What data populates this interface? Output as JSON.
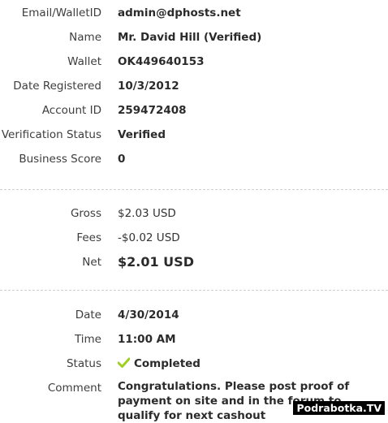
{
  "account": {
    "email_label": "Email/WalletID",
    "email_value": "admin@dphosts.net",
    "name_label": "Name",
    "name_value": "Mr. David Hill (Verified)",
    "wallet_label": "Wallet",
    "wallet_value": "OK449640153",
    "registered_label": "Date Registered",
    "registered_value": "10/3/2012",
    "account_id_label": "Account ID",
    "account_id_value": "259472408",
    "verification_label": "Verification Status",
    "verification_value": "Verified",
    "score_label": "Business Score",
    "score_value": "0"
  },
  "amounts": {
    "gross_label": "Gross",
    "gross_value": "$2.03 USD",
    "fees_label": "Fees",
    "fees_value": "-$0.02 USD",
    "net_label": "Net",
    "net_value": "$2.01 USD"
  },
  "transaction": {
    "date_label": "Date",
    "date_value": "4/30/2014",
    "time_label": "Time",
    "time_value": "11:00 AM",
    "status_label": "Status",
    "status_value": "Completed",
    "status_icon": "check-icon",
    "comment_label": "Comment",
    "comment_value": "Congratulations. Please post proof of payment on site and in the forum to qualify for next cashout"
  },
  "watermark": "Podrabotka.TV",
  "colors": {
    "check_green": "#9fcf1f",
    "separator": "#cfcfcf"
  }
}
